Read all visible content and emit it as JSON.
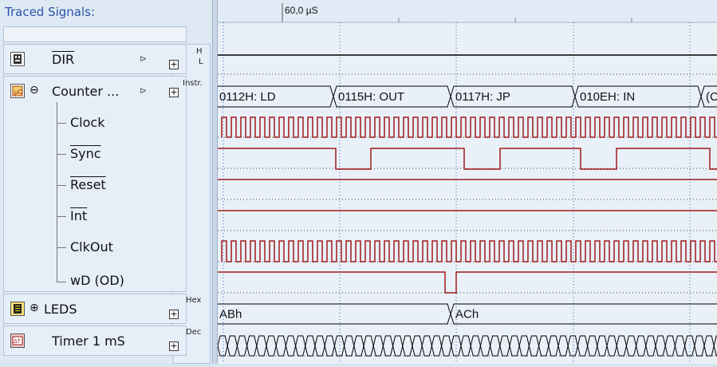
{
  "panel": {
    "title": "Traced Signals:",
    "search_value": ""
  },
  "signals": [
    {
      "name": "DIR",
      "icon": "chip-icon",
      "type_label_top": "H",
      "type_label_bottom": "L"
    },
    {
      "name": "Counter ...",
      "icon": "microcontroller-icon",
      "type_label": "Instr.",
      "children": [
        "Clock",
        "Sync",
        "Reset",
        "Int",
        "ClkOut",
        "wD (OD)"
      ]
    },
    {
      "name": "LEDS",
      "icon": "led-icon",
      "type_label": "Hex"
    },
    {
      "name": "Timer 1 mS",
      "icon": "timer-icon",
      "type_label": "Dec"
    }
  ],
  "timeline": {
    "marker_label": "60,0 µS"
  },
  "waveforms": {
    "instructions": [
      "0112H: LD",
      "0115H: OUT",
      "0117H: JP",
      "010EH: IN",
      "(C"
    ],
    "leds_values": [
      "ABh",
      "ACh"
    ]
  },
  "colors": {
    "signal_red": "#a01a1a",
    "signal_black": "#000000",
    "title_blue": "#2a53a8",
    "grid_blue": "#3c5fb0"
  }
}
